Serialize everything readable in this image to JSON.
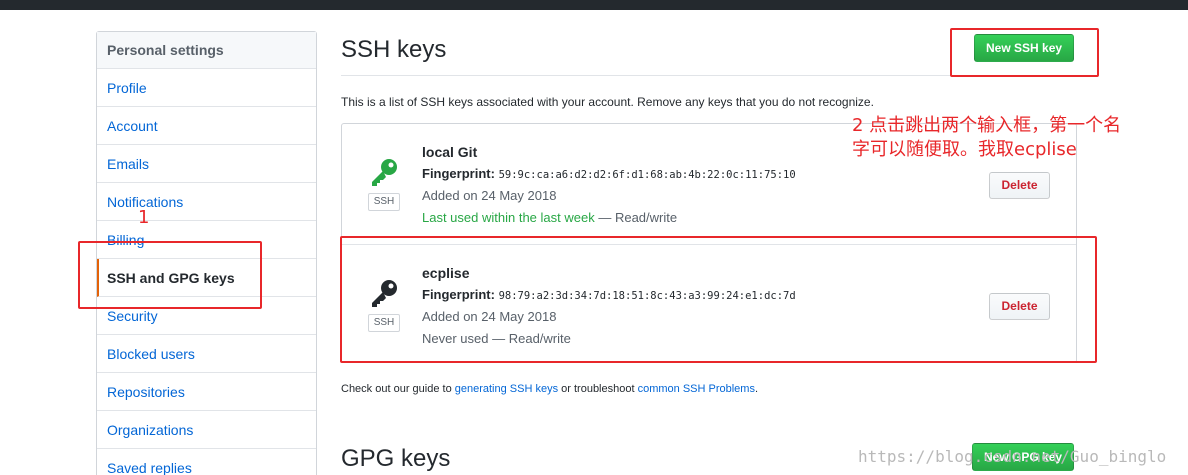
{
  "sidebar": {
    "header": "Personal settings",
    "items": [
      {
        "label": "Profile"
      },
      {
        "label": "Account"
      },
      {
        "label": "Emails"
      },
      {
        "label": "Notifications"
      },
      {
        "label": "Billing"
      },
      {
        "label": "SSH and GPG keys",
        "selected": true
      },
      {
        "label": "Security"
      },
      {
        "label": "Blocked users"
      },
      {
        "label": "Repositories"
      },
      {
        "label": "Organizations"
      },
      {
        "label": "Saved replies"
      }
    ]
  },
  "ssh": {
    "title": "SSH keys",
    "new_button": "New SSH key",
    "intro": "This is a list of SSH keys associated with your account. Remove any keys that you do not recognize.",
    "keys": [
      {
        "name": "local Git",
        "fingerprint_label": "Fingerprint:",
        "fingerprint": "59:9c:ca:a6:d2:d2:6f:d1:68:ab:4b:22:0c:11:75:10",
        "added": "Added on 24 May 2018",
        "last_used": "Last used within the last week",
        "access": "— Read/write",
        "badge": "SSH",
        "delete_label": "Delete",
        "icon_color": "#28a745"
      },
      {
        "name": "ecplise",
        "fingerprint_label": "Fingerprint:",
        "fingerprint": "98:79:a2:3d:34:7d:18:51:8c:43:a3:99:24:e1:dc:7d",
        "added": "Added on 24 May 2018",
        "last_used": "Never used",
        "access": "— Read/write",
        "badge": "SSH",
        "delete_label": "Delete",
        "icon_color": "#24292e"
      }
    ],
    "footer": {
      "prefix": "Check out our guide to ",
      "link1": "generating SSH keys",
      "middle": " or troubleshoot ",
      "link2": "common SSH Problems",
      "suffix": "."
    }
  },
  "gpg": {
    "title": "GPG keys",
    "new_button": "New GPG key"
  },
  "annotations": {
    "step1": "1",
    "step2_line1": "2 点击跳出两个输入框，第一个名",
    "step2_line2": "字可以随便取。我取ecplise",
    "color": "#e8272a"
  },
  "watermark": "https://blog.csdn.net/Guo_binglo"
}
